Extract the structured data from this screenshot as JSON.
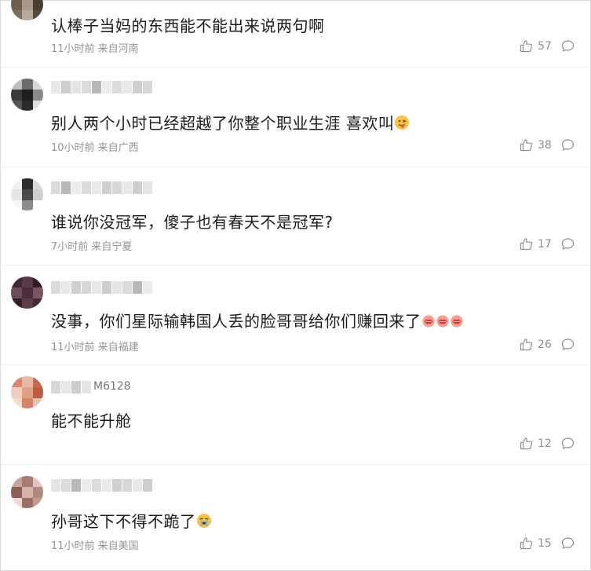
{
  "comments": [
    {
      "text": "认棒子当妈的东西能不能出来说两句啊",
      "meta": "11小时前 来自河南",
      "likes": "57",
      "username_visible": "",
      "avatar_colors": [
        "#5a4c3c",
        "#8f8070",
        "#3a3026",
        "#6e5e4e",
        "#a89a88",
        "#4a3e32",
        "#7c6e5e",
        "#b8aa98",
        "#584a3c"
      ]
    },
    {
      "text": "别人两个小时已经超越了你整个职业生涯 喜欢叫",
      "meta": "10小时前 来自广西",
      "likes": "38",
      "username_visible": "",
      "avatar_colors": [
        "#bfbfbf",
        "#6b6b6b",
        "#d6d6d6",
        "#3a3a3a",
        "#1f1f1f",
        "#8a8a8a",
        "#555555",
        "#2b2b2b",
        "#e0e0e0"
      ]
    },
    {
      "text": "谁说你没冠军，傻子也有春天不是冠军?",
      "meta": "7小时前 来自宁夏",
      "likes": "17",
      "username_visible": "",
      "avatar_colors": [
        "#f0f0f0",
        "#2e2e2e",
        "#d9d9d9",
        "#e6e6e6",
        "#4a4a4a",
        "#cfcfcf",
        "#f5f5f5",
        "#8c8c8c",
        "#ffffff"
      ]
    },
    {
      "text": "没事，你们星际输韩国人丢的脸哥哥给你们赚回来了",
      "meta": "11小时前 来自福建",
      "likes": "26",
      "username_visible": "",
      "avatar_colors": [
        "#3d2a34",
        "#5a3a48",
        "#2c1e26",
        "#6e4a5a",
        "#4a2e3c",
        "#7a5566",
        "#301f28",
        "#5e3c4c",
        "#402a36"
      ]
    },
    {
      "text": "能不能升舱",
      "meta": "",
      "likes": "12",
      "username_visible": "M6128",
      "avatar_colors": [
        "#d98a6e",
        "#e8b9a3",
        "#c46a4e",
        "#f0cdbd",
        "#e0a086",
        "#b85c42",
        "#f5ddd0",
        "#d4826a",
        "#e9bfae"
      ]
    },
    {
      "text": "孙哥这下不得不跪了",
      "meta": "11小时前 来自美国",
      "likes": "15",
      "username_visible": "",
      "avatar_colors": [
        "#c9a49a",
        "#a87c72",
        "#e0c4bc",
        "#8c5e54",
        "#d6b2a8",
        "#b08a80",
        "#eedad4",
        "#9c6e64",
        "#c49a90"
      ]
    }
  ],
  "colors": {
    "text": "#1b1b1b",
    "meta": "#939393",
    "icon": "#8f8f8f",
    "divider": "#eeeeee"
  },
  "icons": {
    "like": "thumb-up-icon",
    "reply": "comment-bubble-icon"
  }
}
